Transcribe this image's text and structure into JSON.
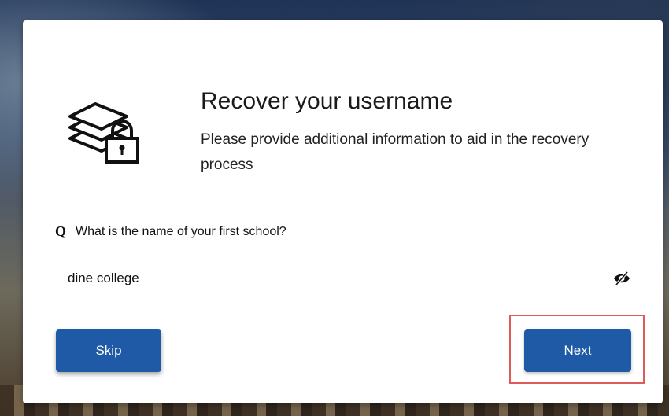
{
  "page": {
    "title": "Recover your username",
    "subtitle": "Please provide additional information to aid in the recovery process"
  },
  "question": {
    "marker": "Q",
    "text": "What is the name of your first school?"
  },
  "answer": {
    "value": "dine college",
    "toggle_icon": "eye-slash-icon"
  },
  "buttons": {
    "skip_label": "Skip",
    "next_label": "Next"
  },
  "icons": {
    "logo": "stacked-layers-lock-icon"
  },
  "colors": {
    "button": "#1f5aa6",
    "highlight": "#e05a5a"
  }
}
